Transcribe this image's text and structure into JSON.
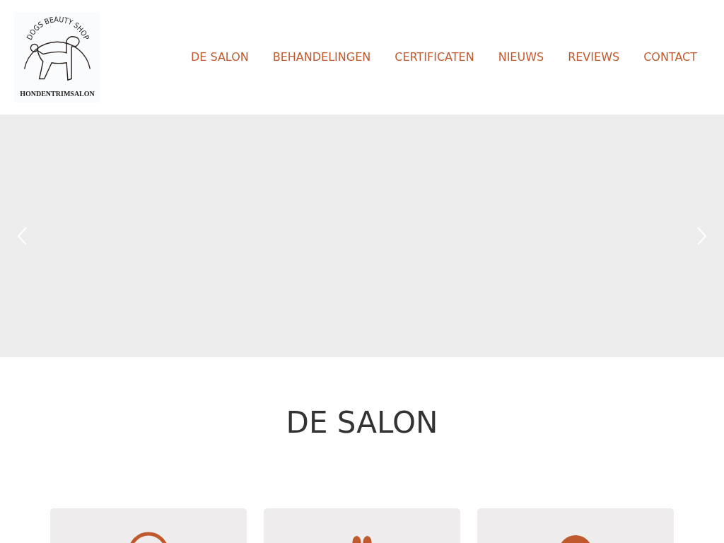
{
  "logo": {
    "arc_text": "DOGS BEAUTY SHOP",
    "subtitle": "HONDENTRIMSALON"
  },
  "nav": [
    {
      "label": "DE SALON"
    },
    {
      "label": "BEHANDELINGEN"
    },
    {
      "label": "CERTIFICATEN"
    },
    {
      "label": "NIEUWS"
    },
    {
      "label": "REVIEWS"
    },
    {
      "label": "CONTACT"
    }
  ],
  "section": {
    "title": "DE SALON"
  },
  "cards": [
    {
      "kind": "ring"
    },
    {
      "kind": "paw"
    },
    {
      "kind": "dot"
    }
  ]
}
